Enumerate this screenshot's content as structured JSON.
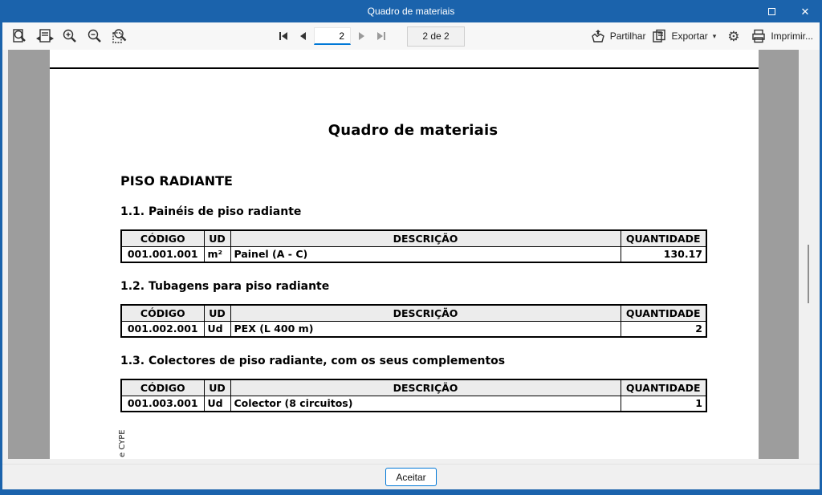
{
  "titlebar": {
    "title": "Quadro de materiais"
  },
  "toolbar": {
    "page_input": "2",
    "page_indicator": "2 de 2",
    "share_label": "Partilhar",
    "export_label": "Exportar",
    "print_label": "Imprimir..."
  },
  "icons": {
    "zoom_page": "page-with-magnifier",
    "fit_width": "page-with-horizontal-arrows",
    "zoom_in": "magnifier-plus",
    "zoom_out": "magnifier-minus",
    "zoom_window": "magnifier-over-region",
    "first_page": "bar-left-triangle",
    "prev_page": "left-triangle",
    "next_page": "right-triangle",
    "last_page": "right-triangle-bar",
    "share": "hand-with-arrow",
    "export": "overlapping-pages",
    "settings": "⚙",
    "print": "printer",
    "caret_down": "▾",
    "maximize": "□",
    "close": "✕"
  },
  "document": {
    "title": "Quadro de materiais",
    "chapter": "PISO RADIANTE",
    "watermark": "e CYPE",
    "table_headers": [
      "CÓDIGO",
      "UD",
      "DESCRIÇÃO",
      "QUANTIDADE"
    ],
    "sections": [
      {
        "title": "1.1. Painéis de piso radiante",
        "row": {
          "codigo": "001.001.001",
          "ud": "m²",
          "descricao": "Painel (A - C)",
          "quantidade": "130.17"
        }
      },
      {
        "title": "1.2. Tubagens para piso radiante",
        "row": {
          "codigo": "001.002.001",
          "ud": "Ud",
          "descricao": "PEX (L 400 m)",
          "quantidade": "2"
        }
      },
      {
        "title": "1.3. Colectores de piso radiante, com os seus complementos",
        "row": {
          "codigo": "001.003.001",
          "ud": "Ud",
          "descricao": "Colector  (8  circuitos)",
          "quantidade": "1"
        }
      }
    ]
  },
  "footer": {
    "accept_label": "Aceitar"
  },
  "colors": {
    "titlebar": "#1b63ac",
    "accent": "#0078d7",
    "doc_background": "#9d9d9d",
    "table_header_bg": "#ececec"
  }
}
